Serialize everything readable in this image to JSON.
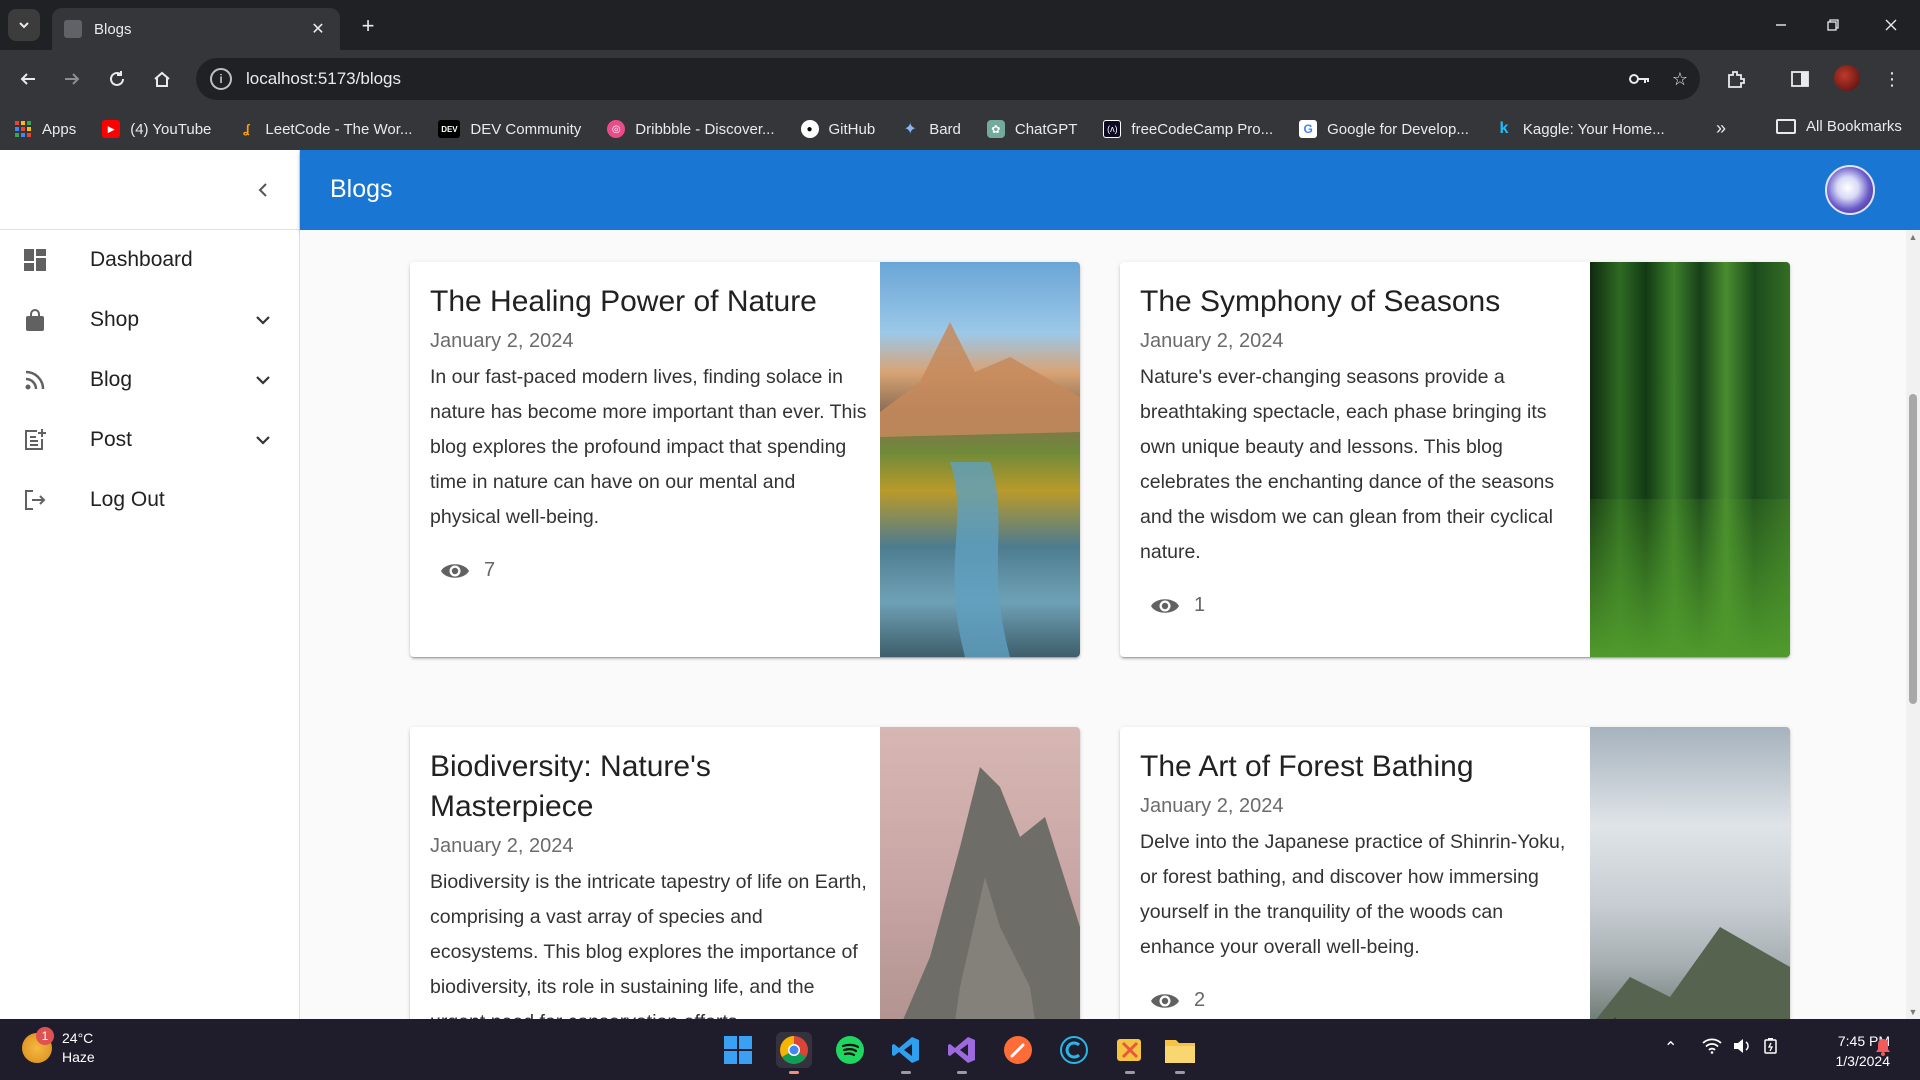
{
  "browser": {
    "tab_title": "Blogs",
    "url": "localhost:5173/blogs",
    "bookmarks": [
      {
        "label": "Apps",
        "icon": "apps-grid-icon",
        "color": "#4285f4"
      },
      {
        "label": "(4) YouTube",
        "icon": "youtube-icon",
        "color": "#ff0000"
      },
      {
        "label": "LeetCode - The Wor...",
        "icon": "leetcode-icon",
        "color": "#ffa116"
      },
      {
        "label": "DEV Community",
        "icon": "dev-icon",
        "color": "#000000"
      },
      {
        "label": "Dribbble - Discover...",
        "icon": "dribbble-icon",
        "color": "#ea4c89"
      },
      {
        "label": "GitHub",
        "icon": "github-icon",
        "color": "#ffffff"
      },
      {
        "label": "Bard",
        "icon": "bard-icon",
        "color": "#8ab4f8"
      },
      {
        "label": "ChatGPT",
        "icon": "chatgpt-icon",
        "color": "#74aa9c"
      },
      {
        "label": "freeCodeCamp Pro...",
        "icon": "freecodecamp-icon",
        "color": "#0a0a23"
      },
      {
        "label": "Google for Develop...",
        "icon": "google-icon",
        "color": "#4285f4"
      },
      {
        "label": "Kaggle: Your Home...",
        "icon": "kaggle-icon",
        "color": "#20beff"
      }
    ],
    "all_bookmarks": "All Bookmarks"
  },
  "sidebar": {
    "items": [
      {
        "label": "Dashboard",
        "icon": "dashboard-icon",
        "has_chevron": false
      },
      {
        "label": "Shop",
        "icon": "shopping-bag-icon",
        "has_chevron": true
      },
      {
        "label": "Blog",
        "icon": "rss-feed-icon",
        "has_chevron": true
      },
      {
        "label": "Post",
        "icon": "post-add-icon",
        "has_chevron": true
      },
      {
        "label": "Log Out",
        "icon": "logout-icon",
        "has_chevron": false
      }
    ]
  },
  "appbar": {
    "title": "Blogs",
    "color": "#1976d2"
  },
  "blogs": [
    {
      "title": "The Healing Power of Nature",
      "date": "January 2, 2024",
      "excerpt": "In our fast-paced modern lives, finding solace in nature has become more important than ever. This blog explores the profound impact that spending time in nature can have on our mental and physical well-being.",
      "views": "7",
      "image": "canyon-river-image"
    },
    {
      "title": "The Symphony of Seasons",
      "date": "January 2, 2024",
      "excerpt": "Nature's ever-changing seasons provide a breathtaking spectacle, each phase bringing its own unique beauty and lessons. This blog celebrates the enchanting dance of the seasons and the wisdom we can glean from their cyclical nature.",
      "views": "1",
      "image": "green-forest-image"
    },
    {
      "title": "Biodiversity: Nature's Masterpiece",
      "date": "January 2, 2024",
      "excerpt": "Biodiversity is the intricate tapestry of life on Earth, comprising a vast array of species and ecosystems. This blog explores the importance of biodiversity, its role in sustaining life, and the urgent need for conservation efforts.",
      "views": "",
      "image": "rocky-peak-image"
    },
    {
      "title": "The Art of Forest Bathing",
      "date": "January 2, 2024",
      "excerpt": "Delve into the Japanese practice of Shinrin-Yoku, or forest bathing, and discover how immersing yourself in the tranquility of the woods can enhance your overall well-being.",
      "views": "2",
      "image": "misty-forest-image"
    }
  ],
  "taskbar": {
    "temperature": "24°C",
    "condition": "Haze",
    "notification_count": "1",
    "time": "7:45 PM",
    "date": "1/3/2024"
  }
}
